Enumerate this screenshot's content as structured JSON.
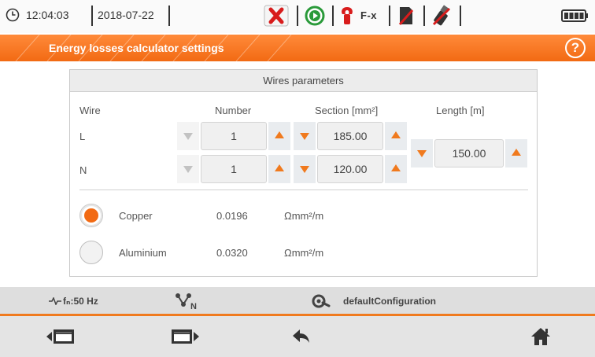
{
  "status": {
    "time": "12:04:03",
    "date": "2018-07-22",
    "fx_label": "F-x",
    "icons": [
      "clock-icon",
      "error-x-icon",
      "recording-play-icon",
      "current-clamp-icon",
      "sd-card-icon",
      "usb-icon",
      "battery-icon"
    ]
  },
  "title": {
    "text": "Energy losses calculator settings",
    "help_label": "?"
  },
  "wires_panel": {
    "heading": "Wires parameters",
    "columns": {
      "wire": "Wire",
      "number": "Number",
      "section": "Section [mm²]",
      "length": "Length [m]"
    },
    "rows": [
      {
        "wire": "L",
        "number": "1",
        "section": "185.00"
      },
      {
        "wire": "N",
        "number": "1",
        "section": "120.00"
      }
    ],
    "length": "150.00",
    "materials": [
      {
        "name": "Copper",
        "value": "0.0196",
        "unit": "Ωmm²/m",
        "selected": true
      },
      {
        "name": "Aluminium",
        "value": "0.0320",
        "unit": "Ωmm²/m",
        "selected": false
      }
    ]
  },
  "infobar": {
    "frequency": "fₙ:50 Hz",
    "configuration": "defaultConfiguration"
  },
  "colors": {
    "accent": "#f26a13",
    "panel_header": "#ececec",
    "bar": "#dedede"
  }
}
